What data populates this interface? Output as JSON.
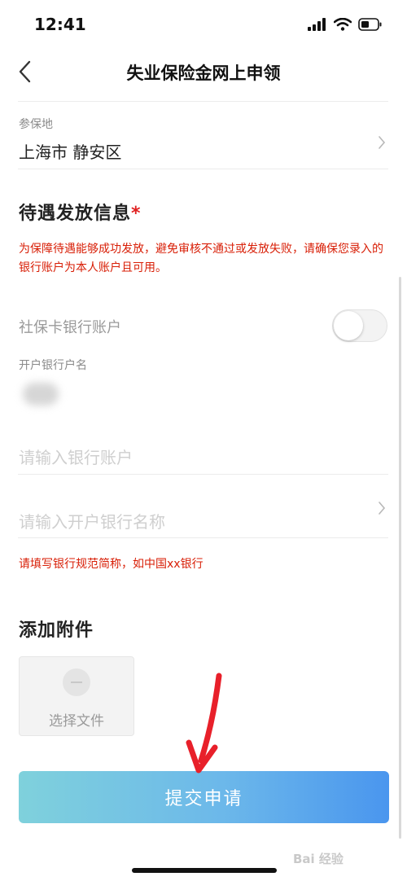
{
  "status_bar": {
    "time": "12:41"
  },
  "nav": {
    "title": "失业保险金网上申领"
  },
  "insured_location": {
    "label": "参保地",
    "value": "上海市 静安区"
  },
  "benefit_section": {
    "title": "待遇发放信息",
    "required_mark": "*",
    "notice": "为保障待遇能够成功发放，避免审核不通过或发放失败，请确保您录入的银行账户为本人账户且可用。"
  },
  "social_card_toggle": {
    "label": "社保卡银行账户",
    "on": false
  },
  "account_name": {
    "label": "开户银行户名"
  },
  "bank_account_input": {
    "placeholder": "请输入银行账户"
  },
  "bank_name_input": {
    "placeholder": "请输入开户银行名称"
  },
  "bank_hint": "请填写银行规范简称，如中国xx银行",
  "attachments": {
    "title": "添加附件",
    "select_label": "选择文件"
  },
  "submit": {
    "label": "提交申请"
  },
  "watermark": "Bai 经验",
  "colors": {
    "accent_start": "#7fd1dc",
    "accent_end": "#4a96ee",
    "warning": "#d81e06",
    "arrow": "#e8202a"
  },
  "icons": [
    "signal-icon",
    "wifi-icon",
    "battery-icon",
    "back-arrow-icon",
    "chevron-right-icon",
    "add-file-icon",
    "red-arrow-annotation"
  ]
}
